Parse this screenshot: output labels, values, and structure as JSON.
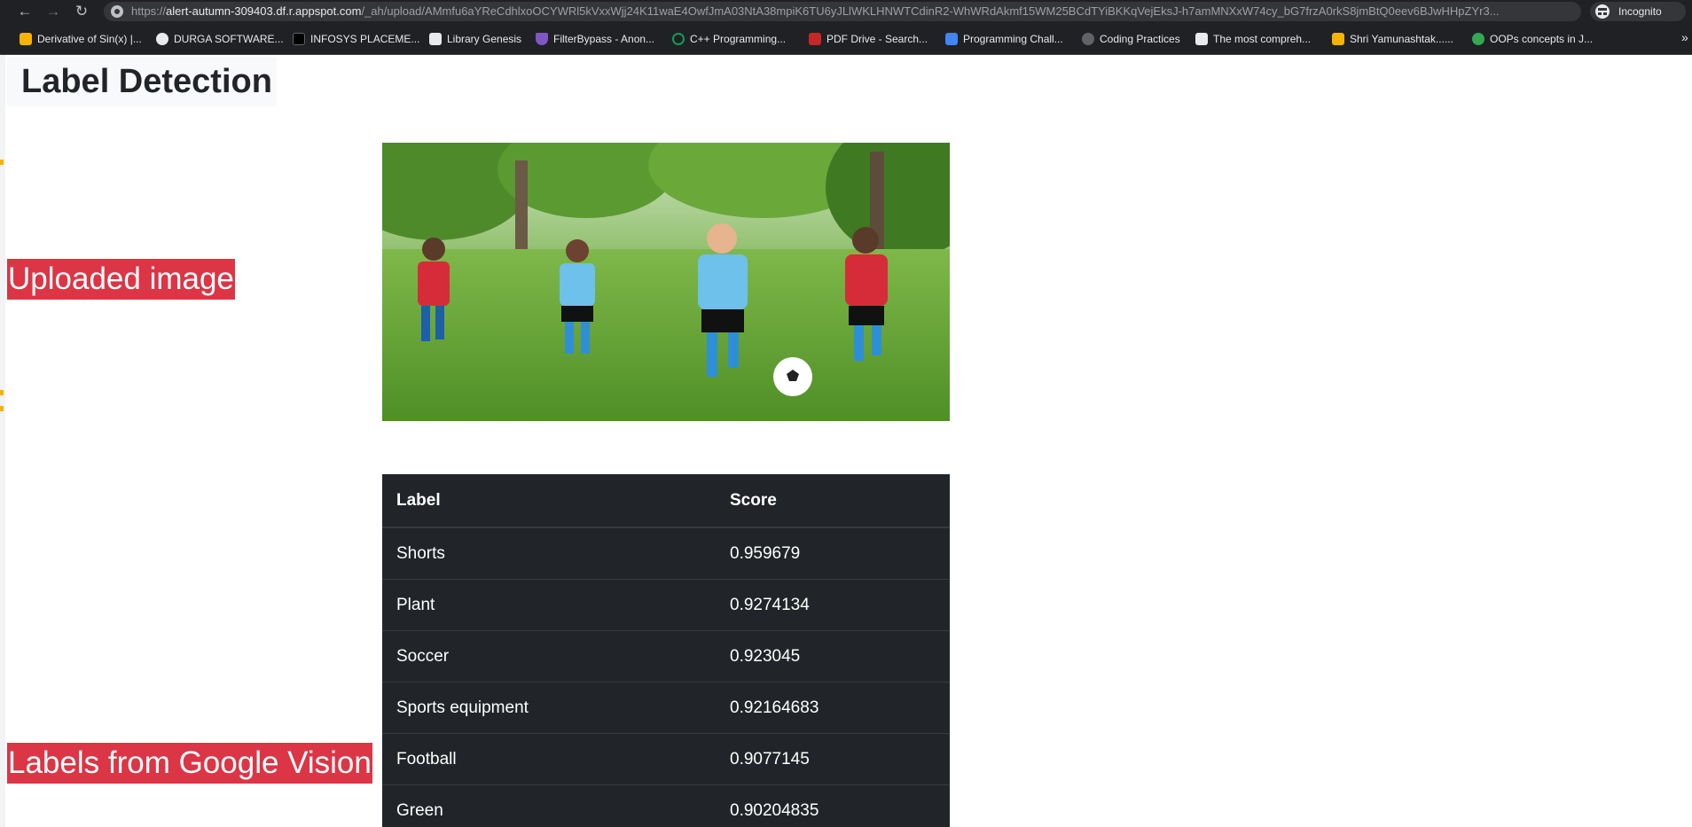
{
  "browser": {
    "url_prefix": "https://",
    "url_domain": "alert-autumn-309403.df.r.appspot.com",
    "url_path": "/_ah/upload/AMmfu6aYReCdhlxoOCYWRl5kVxxWjj24K11waE4OwfJmA03NtA38mpiK6TU6yJLlWKLHNWTCdinR2-WhWRdAkmf15WM25BCdTYiBKKqVejEksJ-h7amMNXxW74cy_bG7frzA0rkS8jmBtQ0eev6BJwHHpZYr3...",
    "incognito_label": "Incognito"
  },
  "bookmarks": [
    {
      "label": "Derivative of Sin(x) |...",
      "color": "#f4b400"
    },
    {
      "label": "DURGA SOFTWARE...",
      "color": "#e8eaed"
    },
    {
      "label": "INFOSYS PLACEME...",
      "color": "#000000"
    },
    {
      "label": "Library Genesis",
      "color": "#e8eaed"
    },
    {
      "label": "FilterBypass - Anon...",
      "color": "#7e57c2"
    },
    {
      "label": "C++ Programming...",
      "color": "#0f9d58"
    },
    {
      "label": "PDF Drive - Search...",
      "color": "#c62828"
    },
    {
      "label": "Programming Chall...",
      "color": "#4285f4"
    },
    {
      "label": "Coding Practices",
      "color": "#5f6368"
    },
    {
      "label": "The most compreh...",
      "color": "#e8eaed"
    },
    {
      "label": "Shri Yamunashtak......",
      "color": "#f4b400"
    },
    {
      "label": "OOPs concepts in J...",
      "color": "#34a853"
    }
  ],
  "page": {
    "title": "Label Detection",
    "uploaded_label": "Uploaded image",
    "labels_heading": "Labels from Google Vision"
  },
  "table": {
    "headers": [
      "Label",
      "Score"
    ],
    "rows": [
      [
        "Shorts",
        "0.959679"
      ],
      [
        "Plant",
        "0.9274134"
      ],
      [
        "Soccer",
        "0.923045"
      ],
      [
        "Sports equipment",
        "0.92164683"
      ],
      [
        "Football",
        "0.9077145"
      ],
      [
        "Green",
        "0.90204835"
      ]
    ]
  },
  "colors": {
    "label_red": "#dc3545",
    "table_dark": "#212529",
    "title_bg": "#f8f9fa"
  }
}
